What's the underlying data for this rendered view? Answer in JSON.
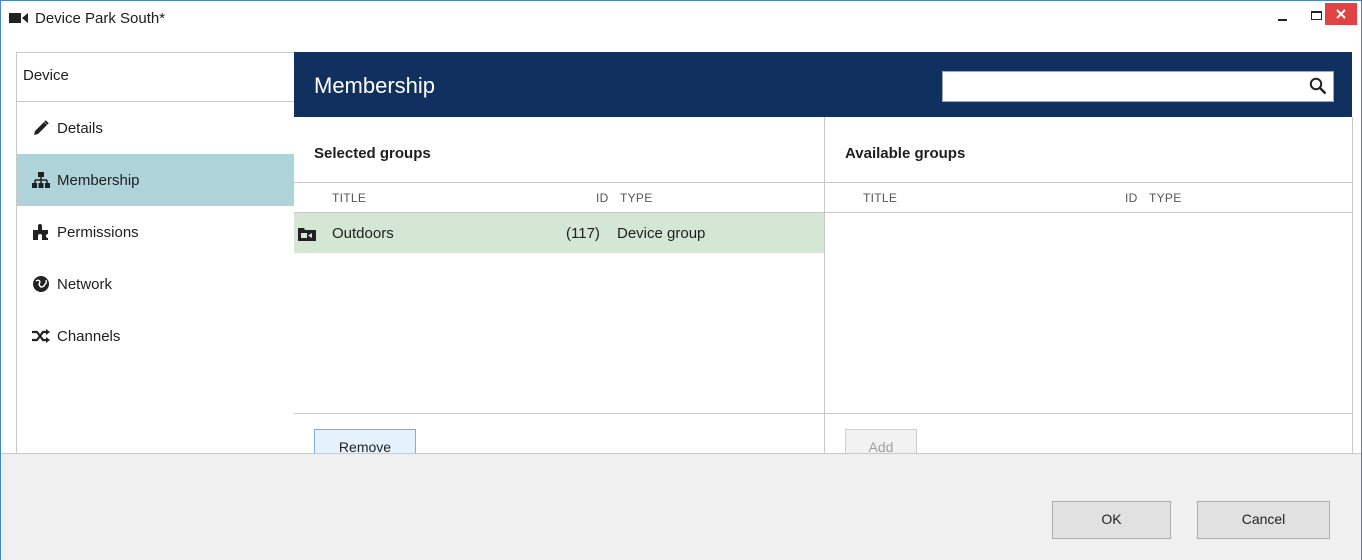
{
  "window": {
    "title": "Device Park South*",
    "app_icon": "video-camera-icon",
    "controls": {
      "minimize": "minimize-icon",
      "maximize": "maximize-icon",
      "close": "close-icon"
    }
  },
  "sidebar": {
    "header": "Device",
    "items": [
      {
        "label": "Details",
        "icon": "pencil-icon",
        "active": false
      },
      {
        "label": "Membership",
        "icon": "hierarchy-icon",
        "active": true
      },
      {
        "label": "Permissions",
        "icon": "puzzle-icon",
        "active": false
      },
      {
        "label": "Network",
        "icon": "globe-icon",
        "active": false
      },
      {
        "label": "Channels",
        "icon": "shuffle-icon",
        "active": false
      }
    ]
  },
  "main": {
    "heading": "Membership",
    "search": {
      "value": "",
      "placeholder": ""
    }
  },
  "selected_groups": {
    "title": "Selected groups",
    "columns": {
      "title": "TITLE",
      "id": "ID",
      "type": "TYPE"
    },
    "rows": [
      {
        "title": "Outdoors",
        "id": "(117)",
        "type": "Device group",
        "icon": "camera-folder-icon"
      }
    ],
    "remove_label": "Remove"
  },
  "available_groups": {
    "title": "Available groups",
    "columns": {
      "title": "TITLE",
      "id": "ID",
      "type": "TYPE"
    },
    "rows": [],
    "add_label": "Add"
  },
  "footer": {
    "ok_label": "OK",
    "cancel_label": "Cancel"
  },
  "colors": {
    "header_bg": "#103060",
    "active_nav_bg": "#aed3d9",
    "selected_row_bg": "#d3e7d4",
    "close_button": "#e04343"
  }
}
